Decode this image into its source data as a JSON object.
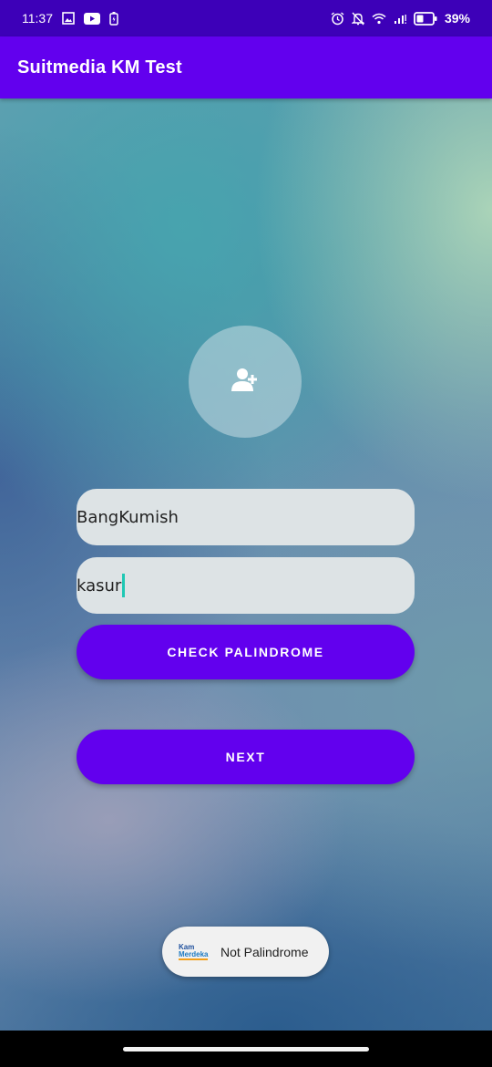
{
  "status_bar": {
    "time": "11:37",
    "battery_percent": "39%",
    "left_icons": [
      "image-icon",
      "youtube-icon",
      "battery-saver-icon"
    ],
    "right_icons": [
      "alarm-icon",
      "notifications-off-icon",
      "wifi-icon",
      "signal-icon",
      "battery-icon"
    ]
  },
  "app_bar": {
    "title": "Suitmedia KM Test"
  },
  "avatar": {
    "icon": "add-person-icon"
  },
  "form": {
    "name_value": "BangKumish",
    "palindrome_value": "kasur"
  },
  "buttons": {
    "check_label": "CHECK PALINDROME",
    "next_label": "NEXT"
  },
  "toast": {
    "logo_icon": "kampus-merdeka-logo",
    "text": "Not Palindrome"
  },
  "colors": {
    "status_bar": "#3d00b8",
    "app_bar": "#6200ee",
    "button": "#6200ee",
    "field_bg": "#dde3e5",
    "cursor": "#1ec8b4"
  }
}
